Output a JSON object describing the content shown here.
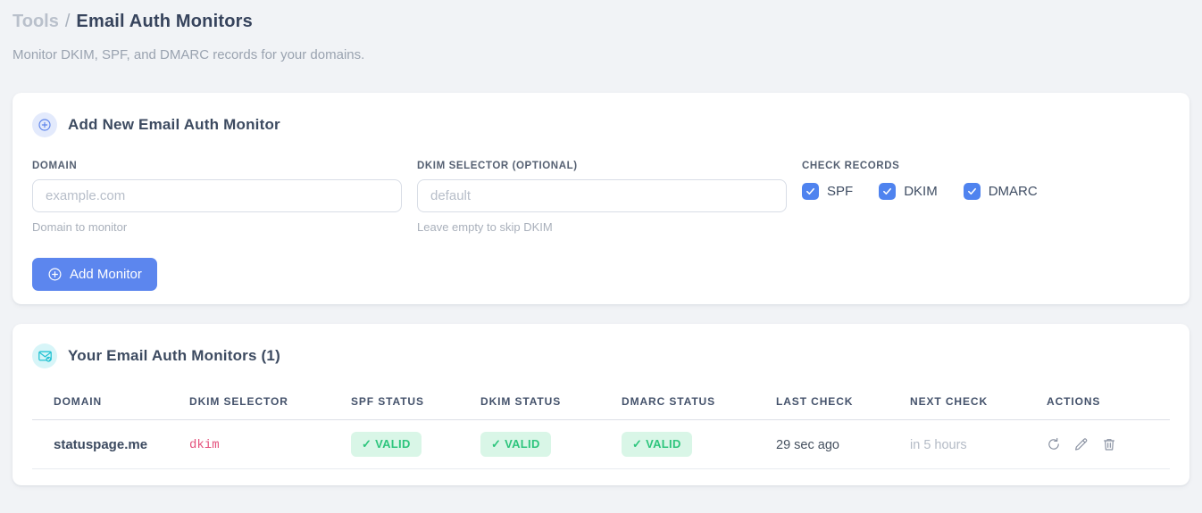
{
  "page": {
    "breadcrumb": {
      "parent": "Tools",
      "separator": "/",
      "current": "Email Auth Monitors"
    },
    "subtitle": "Monitor DKIM, SPF, and DMARC records for your domains."
  },
  "add_form": {
    "title": "Add New Email Auth Monitor",
    "icon": "plus-circle-icon",
    "fields": [
      {
        "label": "DOMAIN",
        "placeholder": "example.com",
        "value": "",
        "hint": "Domain to monitor"
      },
      {
        "label": "DKIM SELECTOR (OPTIONAL)",
        "placeholder": "default",
        "value": "",
        "hint": "Leave empty to skip DKIM"
      }
    ],
    "check_records": {
      "label": "CHECK RECORDS",
      "options": [
        {
          "label": "SPF",
          "checked": true
        },
        {
          "label": "DKIM",
          "checked": true
        },
        {
          "label": "DMARC",
          "checked": true
        }
      ]
    },
    "submit_label": "Add Monitor"
  },
  "monitors": {
    "title": "Your Email Auth Monitors (1)",
    "icon": "envelope-check-icon",
    "table": {
      "headers": [
        "DOMAIN",
        "DKIM SELECTOR",
        "SPF STATUS",
        "DKIM STATUS",
        "DMARC STATUS",
        "LAST CHECK",
        "NEXT CHECK",
        "ACTIONS"
      ],
      "rows": [
        {
          "domain": "statuspage.me",
          "dkim_selector": "dkim",
          "spf_status": "✓ VALID",
          "dkim_status": "✓ VALID",
          "dmarc_status": "✓ VALID",
          "last_check": "29 sec ago",
          "next_check": "in 5 hours",
          "actions": [
            "refresh-icon",
            "edit-icon",
            "delete-icon"
          ]
        }
      ]
    }
  },
  "colors": {
    "accent_blue": "#5c86ee",
    "checkbox_blue": "#4f83ef",
    "badge_green_bg": "#d9f6e7",
    "badge_green_text": "#2ec57d",
    "selector_pink": "#e4527d",
    "icon_circle_blue_bg": "#e3eafc",
    "icon_circle_cyan_bg": "#d7f5f8",
    "icon_cyan": "#26c3d3",
    "page_bg": "#f1f3f6"
  }
}
